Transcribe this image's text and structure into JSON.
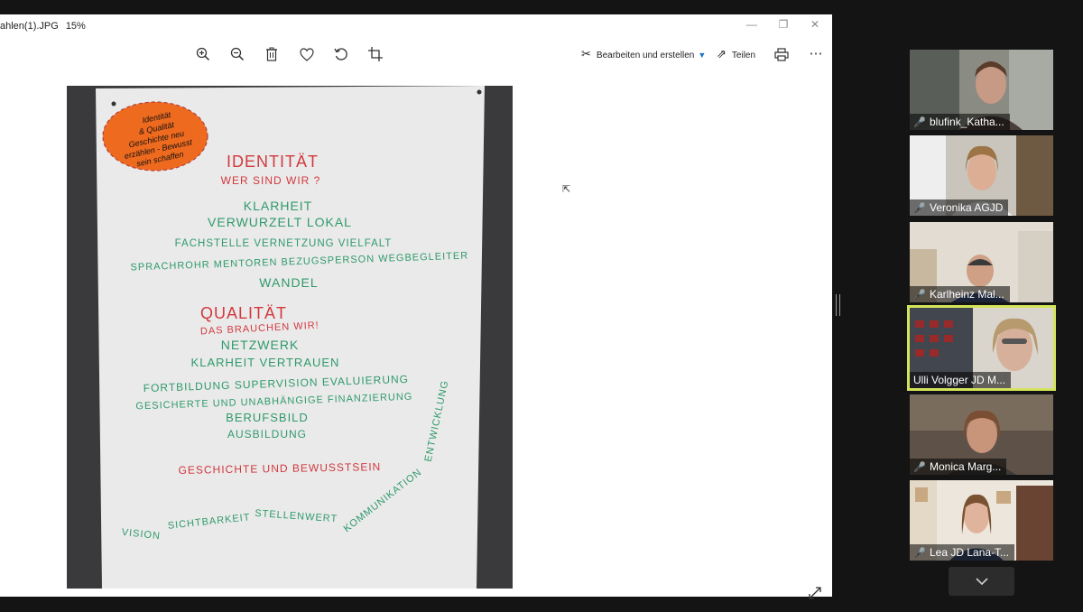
{
  "viewer": {
    "title": "ahlen(1).JPG",
    "zoom": "15%",
    "controls": {
      "minimize": "—",
      "maximize": "❐",
      "close": "✕"
    },
    "toolbar": {
      "edit_label": "Bearbeiten und erstellen",
      "share_label": "Teilen",
      "more_label": "⋯",
      "icons": [
        "zoom-in-icon",
        "zoom-out-icon",
        "delete-icon",
        "favorite-icon",
        "rotate-icon",
        "crop-icon",
        "edit-create-icon",
        "share-icon",
        "print-icon",
        "more-icon",
        "expand-icon"
      ]
    }
  },
  "poster": {
    "badge": [
      "Identität",
      "& Qualität",
      "Geschichte neu",
      "erzählen - Bewusst",
      "sein schaffen"
    ],
    "sections": [
      {
        "heading": "IDENTITÄT",
        "sub": "WER SIND WIR ?",
        "lines": [
          "KLARHEIT",
          "VERWURZELT LOKAL",
          "FACHSTELLE VERNETZUNG VIELFALT",
          "SPRACHROHR MENTOREN BEZUGSPERSON WEGBEGLEITER",
          "WANDEL"
        ]
      },
      {
        "heading": "QUALITÄT",
        "sub": "DAS BRAUCHEN WIR!",
        "lines": [
          "NETZWERK",
          "KLARHEIT VERTRAUEN",
          "FORTBILDUNG SUPERVISION EVALUIERUNG",
          "GESICHERTE UND UNABHÄNGIGE FINANZIERUNG",
          "BERUFSBILD",
          "AUSBILDUNG"
        ]
      }
    ],
    "history": "GESCHICHTE UND BEWUSSTSEIN",
    "arc": [
      "VISION",
      "SICHTBARKEIT",
      "STELLENWERT",
      "KOMMUNIKATION",
      "ENTWICKLUNG"
    ]
  },
  "colors": {
    "poster_red": "#d2393d",
    "poster_green": "#2f9a6a",
    "badge_orange": "#ee6a1e",
    "active_speaker": "#d4e45a",
    "muted_mic": "#e02d2d"
  },
  "participants": [
    {
      "name": "blufink_Katha...",
      "muted": true,
      "active": false
    },
    {
      "name": "Veronika AGJD",
      "muted": true,
      "active": false
    },
    {
      "name": "Karlheinz Mal...",
      "muted": true,
      "active": false
    },
    {
      "name": "Ulli Volgger JD M...",
      "muted": false,
      "active": true
    },
    {
      "name": "Monica Marg...",
      "muted": true,
      "active": false
    },
    {
      "name": "Lea JD Lana-T...",
      "muted": true,
      "active": false
    }
  ],
  "participant_scroll": "chevron-down-icon"
}
